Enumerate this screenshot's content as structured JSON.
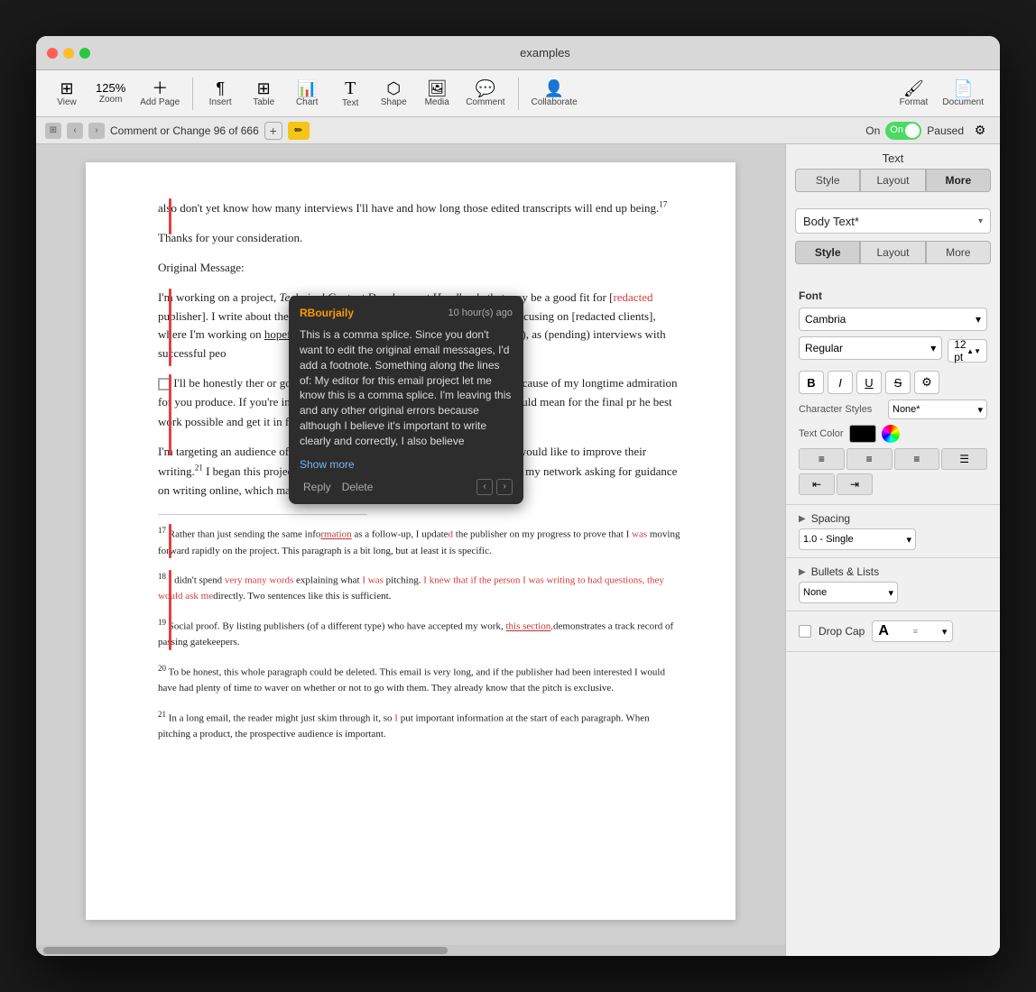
{
  "window": {
    "title": "examples",
    "traffic_lights": [
      "red",
      "yellow",
      "green"
    ]
  },
  "toolbar": {
    "view_label": "View",
    "zoom_label": "Zoom",
    "zoom_value": "125%",
    "add_page_label": "Add Page",
    "insert_label": "Insert",
    "table_label": "Table",
    "chart_label": "Chart",
    "text_label": "Text",
    "shape_label": "Shape",
    "media_label": "Media",
    "comment_label": "Comment",
    "collaborate_label": "Collaborate",
    "format_label": "Format",
    "document_label": "Document"
  },
  "subtoolbar": {
    "comment_nav": "Comment or Change 96 of 666",
    "toggle_on": "On",
    "paused": "Paused"
  },
  "right_panel": {
    "title": "Text",
    "tabs": [
      "Style",
      "Layout",
      "More"
    ],
    "active_tab": "Style",
    "body_text_style": "Body Text*",
    "font": {
      "name": "Cambria",
      "style": "Regular",
      "size": "12 pt"
    },
    "char_styles": "None*",
    "text_color_label": "Text Color",
    "spacing": {
      "label": "Spacing",
      "value": "1.0 - Single"
    },
    "bullets": {
      "label": "Bullets & Lists",
      "value": "None"
    },
    "drop_cap_label": "Drop Cap"
  },
  "comment": {
    "author": "RBourjaily",
    "time": "10 hour(s) ago",
    "body": "This is a comma splice. Since you don't want to edit the original email messages, I'd add a footnote. Something along the lines of: My editor for this email project let me know this is a comma splice. I'm leaving this and any other original errors because although I believe it's important to write clearly and correctly, I also believe",
    "show_more": "Show more",
    "reply_btn": "Reply",
    "delete_btn": "Delete"
  },
  "document": {
    "para1": "also don't yet know how many interviews I'll have and how long those edited transcripts will end up being.",
    "para1_footnote": "17",
    "para2": "Thanks for your consideration.",
    "para3": "Original Message:",
    "para4": "I'm working on a project, Technical Content Development Handbook, that may be a good fit for [redacted publisher]. I write about the craft and business of writing technical content, focusing on [redacted clients], where I'm working on hopefully), and Twilio (again, first piece coming out in), as (pending) interviews with successful peo",
    "para5_prefix": "I'll be honest",
    "para5_text": "ther or go it alone on this project, but [redacted p",
    "para5_rest": "dering because of my longtime admiration for",
    "para5_end": "you produce. If you're interested, I'd like to talk t",
    "para5_more": "hat working together would mean for the final pr",
    "para5_finish": "he best work possible and get it in front of as man",
    "para5_last": "re pretty good at such things.",
    "para5_footnote": "20",
    "para6": "I'm targeting an audience of software engineers and other professionals who would like to improve their writing.",
    "para6_cont": " I began this project after receiving several messages from people in my network asking for guidance on writing online, which made me realize that there is",
    "para6_footnote": "21",
    "footnote17": "17 Rather than just sending the same info",
    "footnote17_tracked": "rmation",
    "footnote17_rest": " as a follow-up, I update",
    "footnote17_tracked2": "d",
    "footnote17_end": " the publisher on my progress to prove that I",
    "footnote17_tracked3": "was",
    "footnote17_end2": " moving forward rapidly on the project. This paragraph is a bit long, but at least it is specific.",
    "footnote18_pre": "18 I didn't spend",
    "footnote18_tracked1": "very many words",
    "footnote18_mid": " explaining what",
    "footnote18_tracked2": "I was",
    "footnote18_rest": " pitching.",
    "footnote18_highlight": " I knew that if the person I was writing to had questions, they would ask me",
    "footnote18_end": "directly. Two sentences like this is sufficient.",
    "footnote19_pre": "19 Social proof. By listing publishers (of a different type) who have accepted my work,",
    "footnote19_link": " this section",
    "footnote19_end": "demonstrates a track record of passing gatekeepers.",
    "footnote20": "20 To be honest, this whole paragraph could be deleted. This email is very long, and if the publisher had been interested I would have had plenty of time to waver on whether or not to go with them. They already know that the pitch is exclusive.",
    "footnote21": "21 In a long email, the reader might just skim through it, so",
    "footnote21_tracked": "I",
    "footnote21_end": " put important information at the start of each paragraph. When pitching a product, the prospective audience is important."
  }
}
